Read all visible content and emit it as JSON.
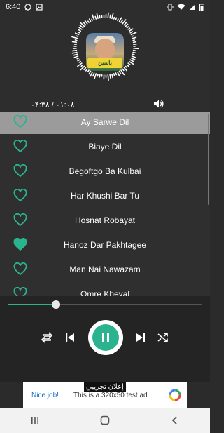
{
  "status_bar": {
    "time": "6:40",
    "left_icons": [
      "whatsapp-icon",
      "gallery-icon"
    ],
    "right_icons": [
      "vibrate-icon",
      "wifi-icon",
      "signal-icon",
      "battery-icon"
    ]
  },
  "player": {
    "album_title": "ياسين",
    "time_readout": "۰۴:۳۸ / ۰۱:۰۸",
    "volume_icon": "volume-icon"
  },
  "tracks": [
    {
      "name": "Ay Sarwe Dil",
      "favorite": false,
      "selected": true
    },
    {
      "name": "Biaye Dil",
      "favorite": false,
      "selected": false
    },
    {
      "name": "Begoftgo Ba Kulbai",
      "favorite": false,
      "selected": false
    },
    {
      "name": "Har Khushi Bar Tu",
      "favorite": false,
      "selected": false
    },
    {
      "name": "Hosnat Robayat",
      "favorite": false,
      "selected": false
    },
    {
      "name": "Hanoz Dar Pakhtagee",
      "favorite": true,
      "selected": false
    },
    {
      "name": "Man Nai Nawazam",
      "favorite": false,
      "selected": false
    },
    {
      "name": "Omre Kheyal",
      "favorite": false,
      "selected": false
    }
  ],
  "seek": {
    "progress": 0.246
  },
  "controls": {
    "repeat_icon": "repeat-icon",
    "previous_icon": "previous-icon",
    "pause_icon": "pause-icon",
    "next_icon": "next-icon",
    "shuffle_icon": "shuffle-icon"
  },
  "ad": {
    "label": "إعلان تجريبي",
    "left_text": "Nice job!",
    "body_text": "This is a 320x50 test ad."
  },
  "colors": {
    "accent": "#2bb38f",
    "selected_row": "#9b9b9b",
    "background": "#2b2b2b"
  }
}
